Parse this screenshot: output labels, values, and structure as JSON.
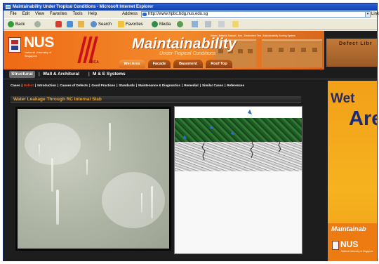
{
  "window": {
    "title": "Maintainability Under Tropical Conditions - Microsoft Internet Explorer"
  },
  "menu": [
    "File",
    "Edit",
    "View",
    "Favorites",
    "Tools",
    "Help"
  ],
  "address": {
    "label": "Address",
    "url": "http://www.hpbc.bdg.nus.edu.sg",
    "links_label": "Links"
  },
  "toolbar": {
    "back": "Back",
    "search": "Search",
    "favorites": "Favorites",
    "media": "Media"
  },
  "banner": {
    "logo_text": "NUS",
    "logo_sub": "National University of Singapore",
    "bca_text": "BCA",
    "title": "Maintainability",
    "subtitle": "Under Tropical Conditions",
    "top_links": "Home | Material Manual | Non - Destructive Test | Maintainability Scoring System",
    "defect_library": "Defect Libr",
    "tabs": [
      {
        "label": "Wet Area",
        "active": true
      },
      {
        "label": "Facade",
        "active": false
      },
      {
        "label": "Basement",
        "active": false
      },
      {
        "label": "Roof Top",
        "active": false
      }
    ]
  },
  "subnav": {
    "items": [
      {
        "label": "Structural",
        "active": true
      },
      {
        "label": "Wall & Architural",
        "active": false
      },
      {
        "label": "M & E Systems",
        "active": false
      }
    ]
  },
  "crumbs": [
    {
      "label": "Cases",
      "highlight": false
    },
    {
      "label": "Defect",
      "highlight": true
    },
    {
      "label": "Introduction",
      "highlight": false
    },
    {
      "label": "Causes of Defects",
      "highlight": false
    },
    {
      "label": "Good Practices",
      "highlight": false
    },
    {
      "label": "Standards",
      "highlight": false
    },
    {
      "label": "Maintenance & Diagnostics",
      "highlight": false
    },
    {
      "label": "Remedial",
      "highlight": false
    },
    {
      "label": "Similar Cases",
      "highlight": false
    },
    {
      "label": "References",
      "highlight": false
    }
  ],
  "section": {
    "title": "Water Leakage Through RC Internal Slab"
  },
  "ad": {
    "line1": "Wet",
    "line2": "Are",
    "maint": "Maintainab",
    "nus": "NUS",
    "nus_sub": "National University of Singapore"
  },
  "colors": {
    "accent_orange": "#f28a2c",
    "dark_background": "#1d1d1d",
    "highlight_red": "#e24b2b",
    "section_title": "#e8a93b"
  }
}
